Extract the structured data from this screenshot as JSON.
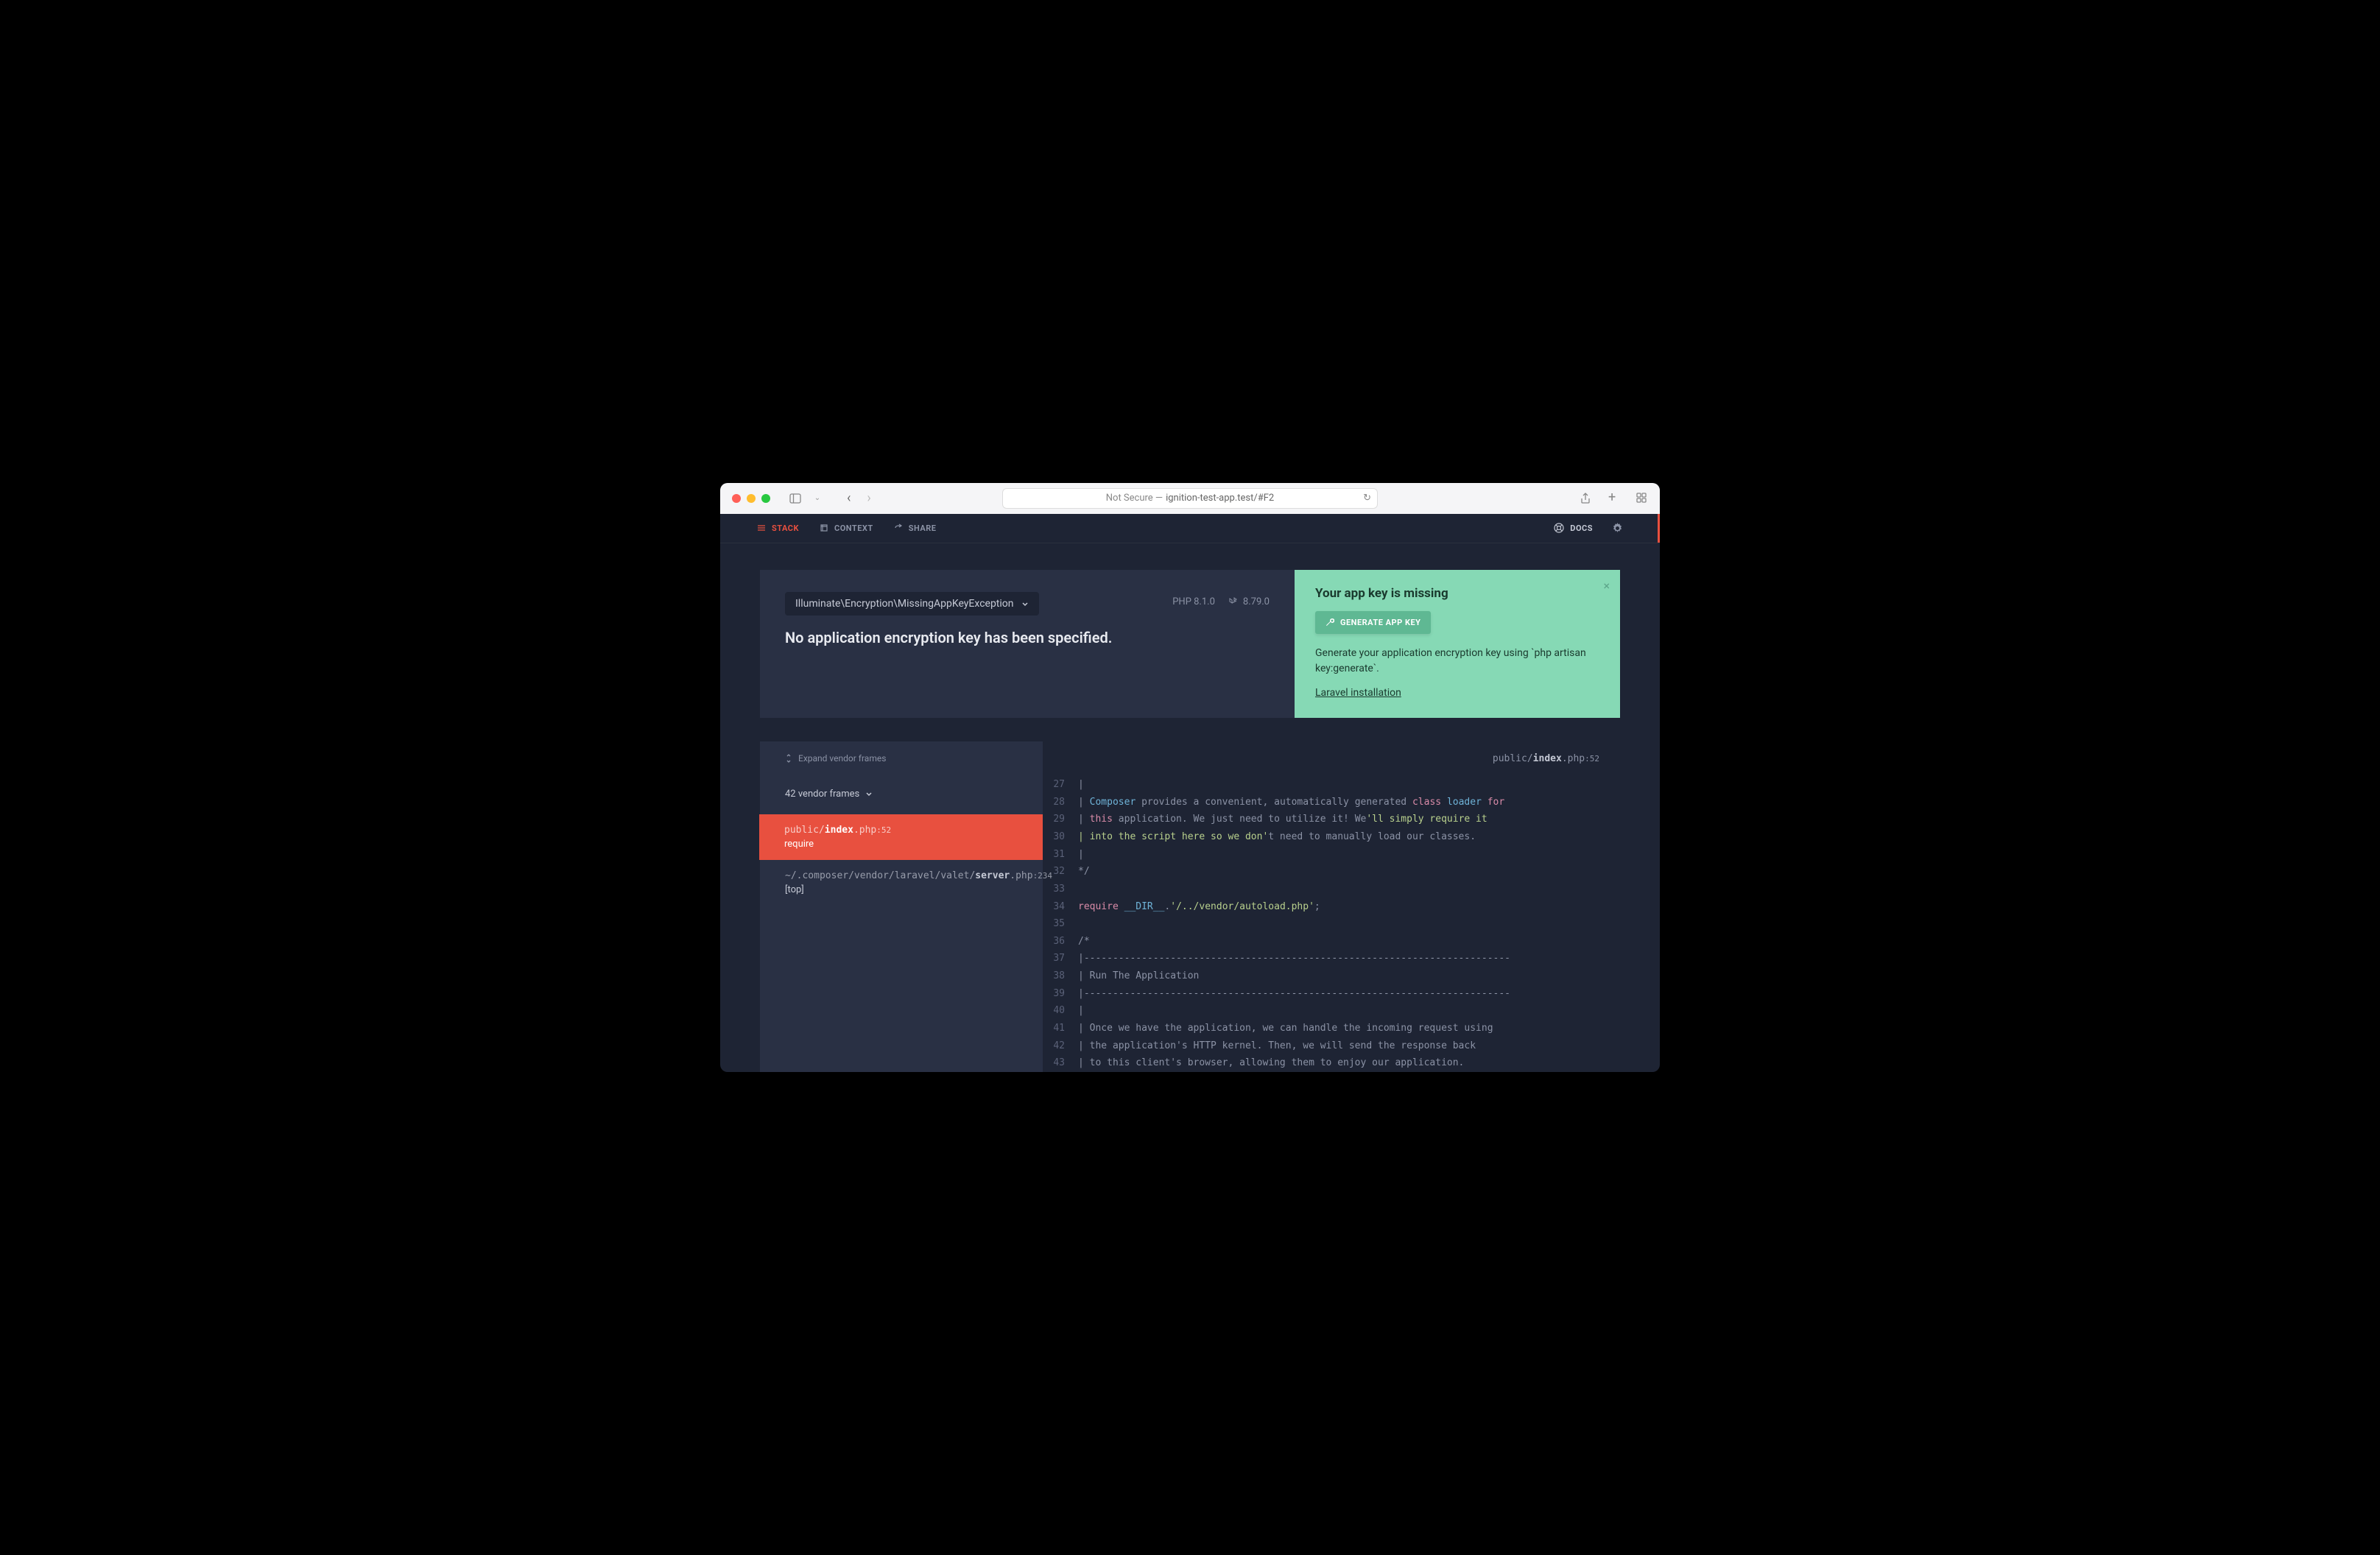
{
  "browser": {
    "url_prefix": "Not Secure — ",
    "url": "ignition-test-app.test/#F2"
  },
  "nav": {
    "stack": "STACK",
    "context": "CONTEXT",
    "share": "SHARE",
    "docs": "DOCS"
  },
  "error": {
    "exception_class": "Illuminate\\Encryption\\MissingAppKeyException",
    "message": "No application encryption key has been specified.",
    "php_version": "PHP 8.1.0",
    "laravel_version": "8.79.0"
  },
  "solution": {
    "title": "Your app key is missing",
    "button": "GENERATE APP KEY",
    "description": "Generate your application encryption key using `php artisan key:generate`.",
    "link_text": "Laravel installation"
  },
  "frames": {
    "expand_label": "Expand vendor frames",
    "vendor_count": "42 vendor frames",
    "active": {
      "path_prefix": "public/",
      "path_file": "index",
      "path_ext": ".php",
      "path_line": ":52",
      "fn": "require"
    },
    "second": {
      "path_prefix": "~/.composer/vendor/laravel/valet/",
      "path_file": "server",
      "path_ext": ".php",
      "path_line": ":234",
      "fn": "[top]"
    }
  },
  "code_header": {
    "prefix": "public/",
    "file": "index",
    "ext": ".php",
    "line": ":52"
  },
  "code_lines": [
    {
      "n": "27",
      "html": "|"
    },
    {
      "n": "28",
      "html": "| <span class='tok-cls'>Composer</span> provides a convenient, automatically generated <span class='tok-kw'>class</span> <span class='tok-cls'>loader</span> <span class='tok-kw'>for</span>"
    },
    {
      "n": "29",
      "html": "| <span class='tok-this'>this</span> application. We just need to utilize it! We<span class='tok-str'>'ll simply require it</span>"
    },
    {
      "n": "30",
      "html": "<span class='tok-str'>| into the script here so we don'</span>t need to manually load our classes."
    },
    {
      "n": "31",
      "html": "|"
    },
    {
      "n": "32",
      "html": "*/"
    },
    {
      "n": "33",
      "html": ""
    },
    {
      "n": "34",
      "html": "<span class='tok-kw'>require</span> <span class='tok-const'>__DIR__</span>.<span class='tok-str'>'/../vendor/autoload.php'</span>;"
    },
    {
      "n": "35",
      "html": ""
    },
    {
      "n": "36",
      "html": "/*"
    },
    {
      "n": "37",
      "html": "|--------------------------------------------------------------------------"
    },
    {
      "n": "38",
      "html": "| Run The Application"
    },
    {
      "n": "39",
      "html": "|--------------------------------------------------------------------------"
    },
    {
      "n": "40",
      "html": "|"
    },
    {
      "n": "41",
      "html": "| Once we have the application, we can handle the incoming request using"
    },
    {
      "n": "42",
      "html": "| the application's HTTP kernel. Then, we will send the response back"
    },
    {
      "n": "43",
      "html": "| to this client's browser, allowing them to enjoy our application."
    }
  ]
}
